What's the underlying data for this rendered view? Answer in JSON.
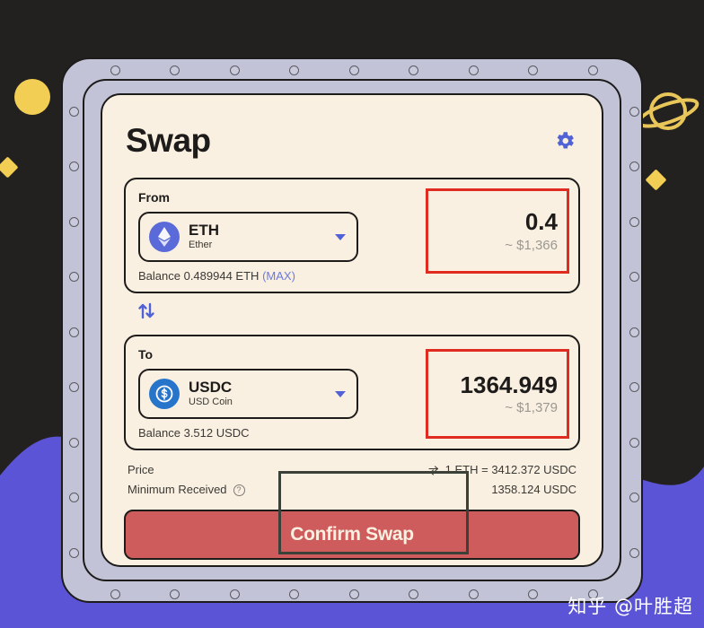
{
  "window": {
    "background_color": "#23211f",
    "wave_color": "#5b54d6",
    "frame_color": "#c2c3d6",
    "card_color": "#faf0e1",
    "accent_color": "#5162d6",
    "highlight_color": "#e02b20",
    "confirm_color": "#cf5c5c"
  },
  "decorations": {
    "yellow_dot": "circle-decoration",
    "diamond_left": "diamond-decoration",
    "diamond_right": "diamond-decoration",
    "saturn": "saturn-planet-decoration"
  },
  "header": {
    "title": "Swap",
    "settings_icon": "gear-icon"
  },
  "from": {
    "label": "From",
    "token": {
      "symbol": "ETH",
      "name": "Ether",
      "icon": "ethereum-token-icon"
    },
    "balance_text": "Balance 0.489944 ETH",
    "max_label": "(MAX)",
    "amount": "0.4",
    "amount_usd": "~ $1,366"
  },
  "switch_icon": "swap-direction-arrows-icon",
  "to": {
    "label": "To",
    "token": {
      "symbol": "USDC",
      "name": "USD Coin",
      "icon": "usdc-token-icon"
    },
    "balance_text": "Balance 3.512 USDC",
    "amount": "1364.949",
    "amount_usd": "~ $1,379"
  },
  "details": {
    "price_label": "Price",
    "price_value": "1 ETH = 3412.372 USDC",
    "price_swap_icon": "rate-toggle-icon",
    "minimum_label": "Minimum Received",
    "minimum_help_icon": "question-mark-icon",
    "minimum_value": "1358.124 USDC"
  },
  "confirm": {
    "label": "Confirm Swap"
  },
  "watermark": {
    "text": "知乎 @叶胜超"
  }
}
